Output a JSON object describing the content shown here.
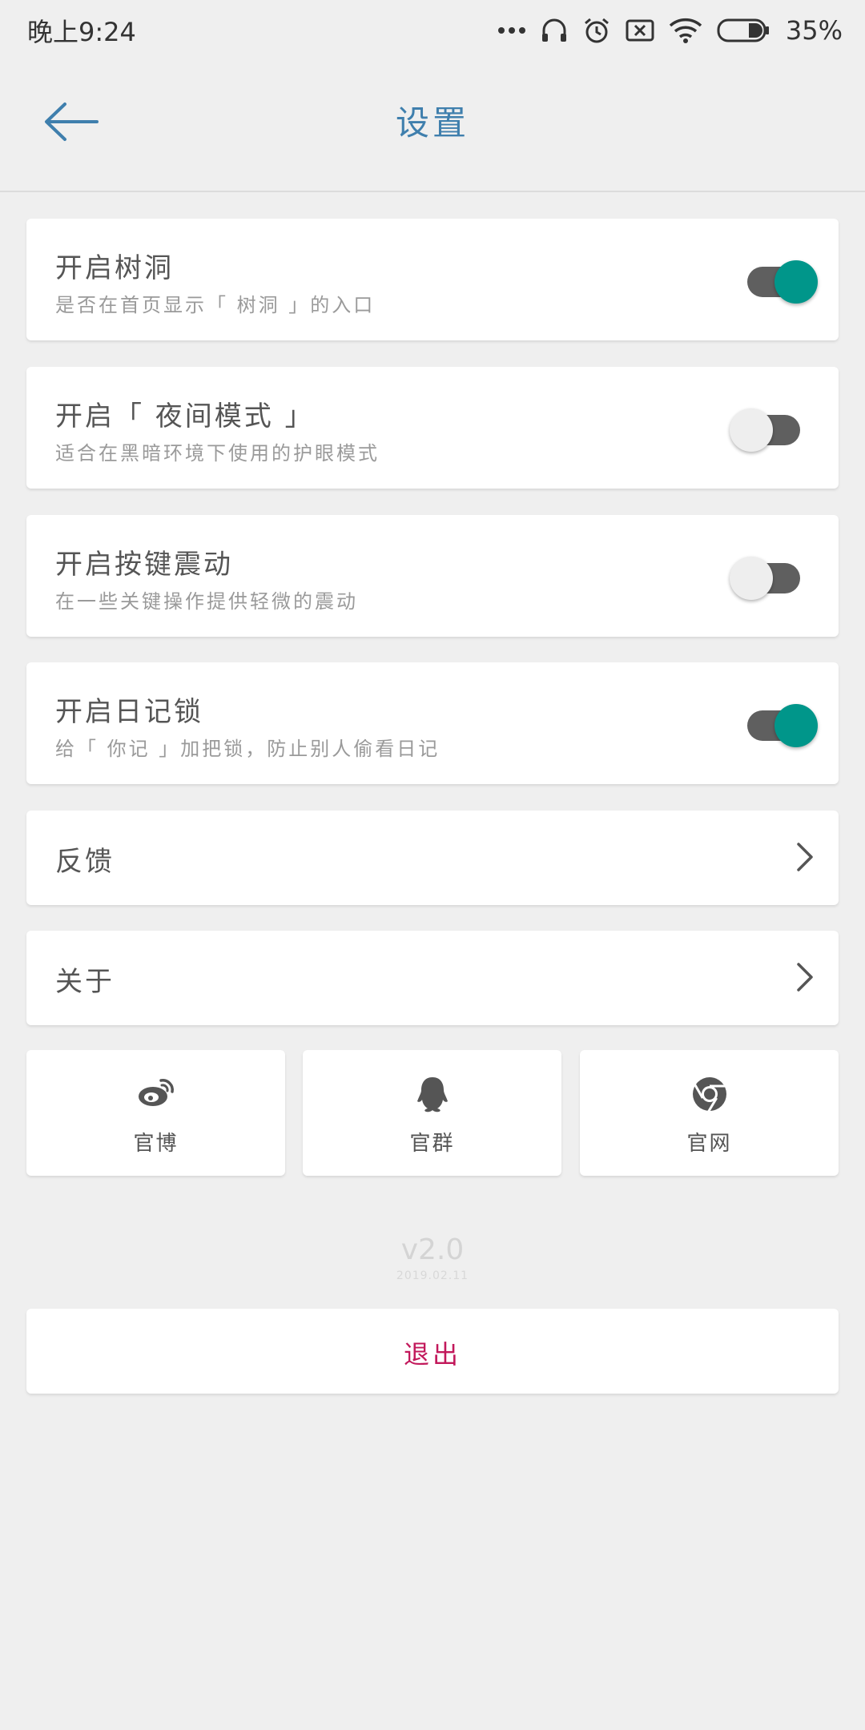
{
  "status_bar": {
    "time": "晚上9:24",
    "battery": "35%",
    "icons": [
      "more-dots-icon",
      "headset-icon",
      "alarm-icon",
      "sim-disabled-icon",
      "wifi-icon",
      "battery-icon"
    ]
  },
  "header": {
    "title": "设置",
    "back_icon": "arrow-left-icon"
  },
  "settings": [
    {
      "title": "开启树洞",
      "subtitle": "是否在首页显示「 树洞 」的入口",
      "enabled": true
    },
    {
      "title": "开启「 夜间模式 」",
      "subtitle": "适合在黑暗环境下使用的护眼模式",
      "enabled": false
    },
    {
      "title": "开启按键震动",
      "subtitle": "在一些关键操作提供轻微的震动",
      "enabled": false
    },
    {
      "title": "开启日记锁",
      "subtitle": "给「 你记 」加把锁，防止别人偷看日记",
      "enabled": true
    }
  ],
  "menu": {
    "feedback": "反馈",
    "about": "关于"
  },
  "social": [
    {
      "label": "官博",
      "icon": "weibo-icon"
    },
    {
      "label": "官群",
      "icon": "qq-icon"
    },
    {
      "label": "官网",
      "icon": "chrome-icon"
    }
  ],
  "app_info": {
    "version": "v2.0",
    "build_date": "2019.02.11"
  },
  "logout": {
    "label": "退出"
  },
  "colors": {
    "accent": "#00968a",
    "title": "#3f7fad",
    "logout": "#c2185b",
    "background": "#efefef"
  }
}
